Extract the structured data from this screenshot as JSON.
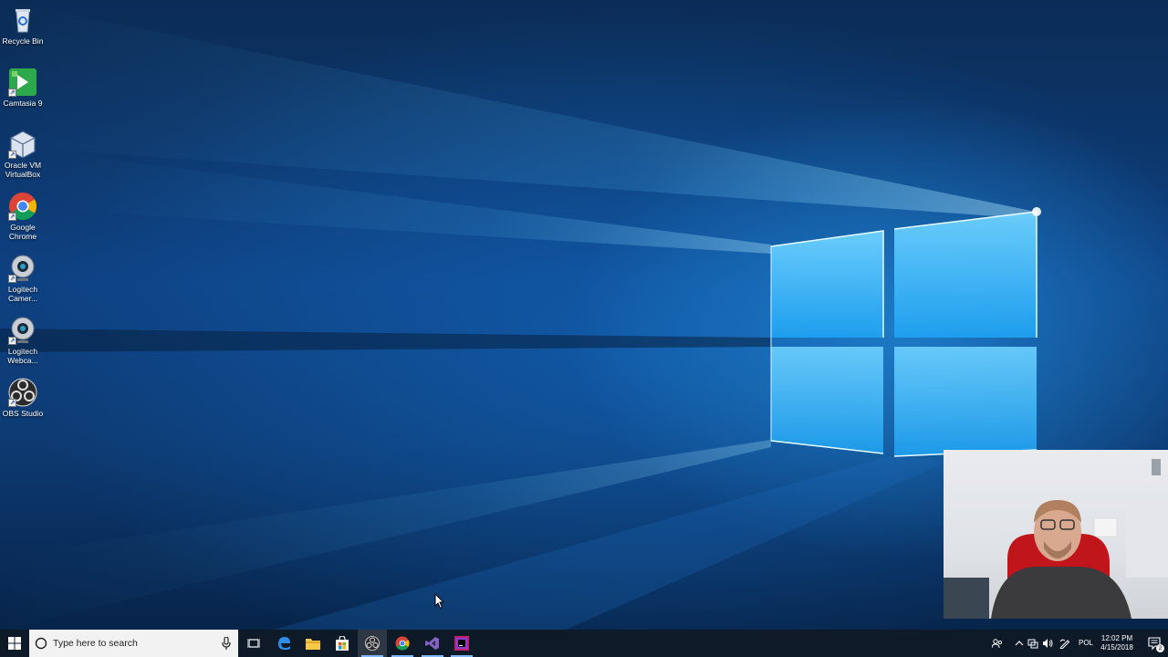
{
  "desktop": {
    "icons": [
      {
        "label": "Recycle Bin",
        "icon": "recycle-bin-icon"
      },
      {
        "label": "Camtasia 9",
        "icon": "camtasia-icon"
      },
      {
        "label": "Oracle VM VirtualBox",
        "icon": "virtualbox-icon"
      },
      {
        "label": "Google Chrome",
        "icon": "chrome-icon"
      },
      {
        "label": "Logitech Camer...",
        "icon": "logitech-camera-icon"
      },
      {
        "label": "Logitech Webca...",
        "icon": "logitech-webcam-icon"
      },
      {
        "label": "OBS Studio",
        "icon": "obs-icon"
      }
    ],
    "wallpaper": "windows-10-hero",
    "accent_color": "#3fb4ff"
  },
  "taskbar": {
    "search_placeholder": "Type here to search",
    "pinned": [
      {
        "name": "task-view",
        "icon": "task-view-icon"
      },
      {
        "name": "edge",
        "icon": "edge-icon"
      },
      {
        "name": "file-explorer",
        "icon": "folder-icon"
      },
      {
        "name": "store",
        "icon": "store-icon"
      },
      {
        "name": "obs",
        "icon": "obs-icon",
        "running": true,
        "active": true
      },
      {
        "name": "chrome",
        "icon": "chrome-icon",
        "running": true
      },
      {
        "name": "visual-studio",
        "icon": "visual-studio-icon",
        "running": true
      },
      {
        "name": "rider",
        "icon": "rider-icon",
        "running": true
      }
    ],
    "language": "POL",
    "time": "12:02 PM",
    "date": "4/15/2018",
    "notification_count": "2"
  }
}
